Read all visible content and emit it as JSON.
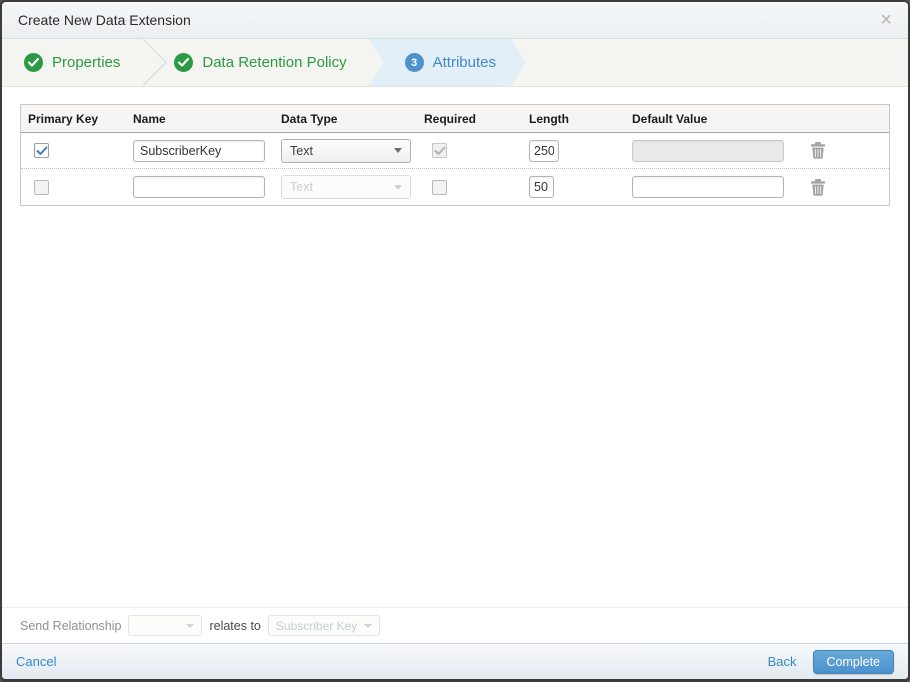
{
  "modal": {
    "title": "Create New Data Extension",
    "close_icon": "×"
  },
  "wizard": {
    "steps": [
      {
        "label": "Properties",
        "status": "complete"
      },
      {
        "label": "Data Retention Policy",
        "status": "complete"
      },
      {
        "label": "Attributes",
        "status": "active",
        "number": "3"
      }
    ]
  },
  "colors": {
    "step_green": "#2c9a44",
    "step_blue": "#4c92cb",
    "active_step_bg": "#e2eef8",
    "link_blue": "#3a86c8",
    "primary_button": "#4b91ce"
  },
  "table": {
    "headers": [
      "Primary Key",
      "Name",
      "Data Type",
      "Required",
      "Length",
      "Default Value"
    ],
    "rows": [
      {
        "primary_key_checked": true,
        "name": "SubscriberKey",
        "data_type": "Text",
        "data_type_disabled": false,
        "required_checked": true,
        "required_disabled": true,
        "length": "250",
        "default_value": "",
        "default_value_disabled": true
      },
      {
        "primary_key_checked": false,
        "name": "",
        "data_type": "Text",
        "data_type_disabled": true,
        "required_checked": false,
        "required_disabled": false,
        "length": "50",
        "default_value": "",
        "default_value_disabled": false
      }
    ]
  },
  "send_relationship": {
    "label": "Send Relationship",
    "relates_to": "relates to",
    "target_value": "Subscriber Key"
  },
  "footer": {
    "cancel": "Cancel",
    "back": "Back",
    "complete": "Complete"
  }
}
